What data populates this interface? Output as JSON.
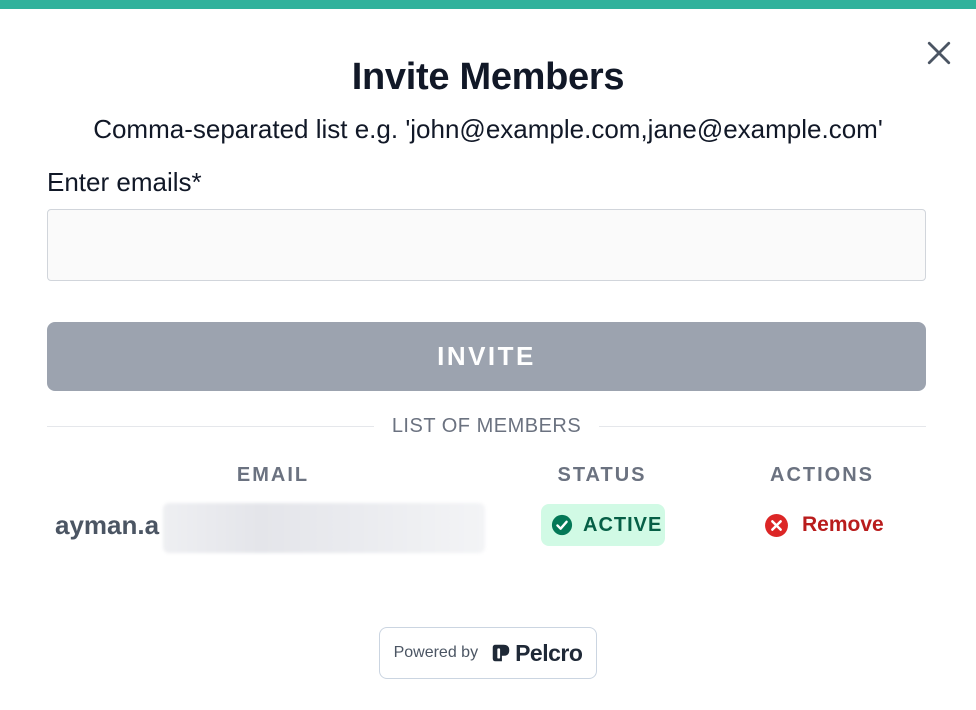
{
  "modal": {
    "title": "Invite Members",
    "subtitle": "Comma-separated list e.g. 'john@example.com,jane@example.com'",
    "email_label": "Enter emails*",
    "email_value": "",
    "invite_label": "INVITE"
  },
  "members": {
    "divider_label": "LIST OF MEMBERS",
    "columns": [
      "EMAIL",
      "STATUS",
      "ACTIONS"
    ],
    "rows": [
      {
        "email": "ayman.a",
        "status": "ACTIVE",
        "action": "Remove"
      }
    ]
  },
  "footer": {
    "powered_by": "Powered by",
    "brand": "Pelcro"
  },
  "colors": {
    "accent": "#31b29c",
    "button_disabled": "#9ca3af",
    "status_active_bg": "#d1fae5",
    "status_active_fg": "#065f46",
    "remove": "#b91c1c"
  }
}
